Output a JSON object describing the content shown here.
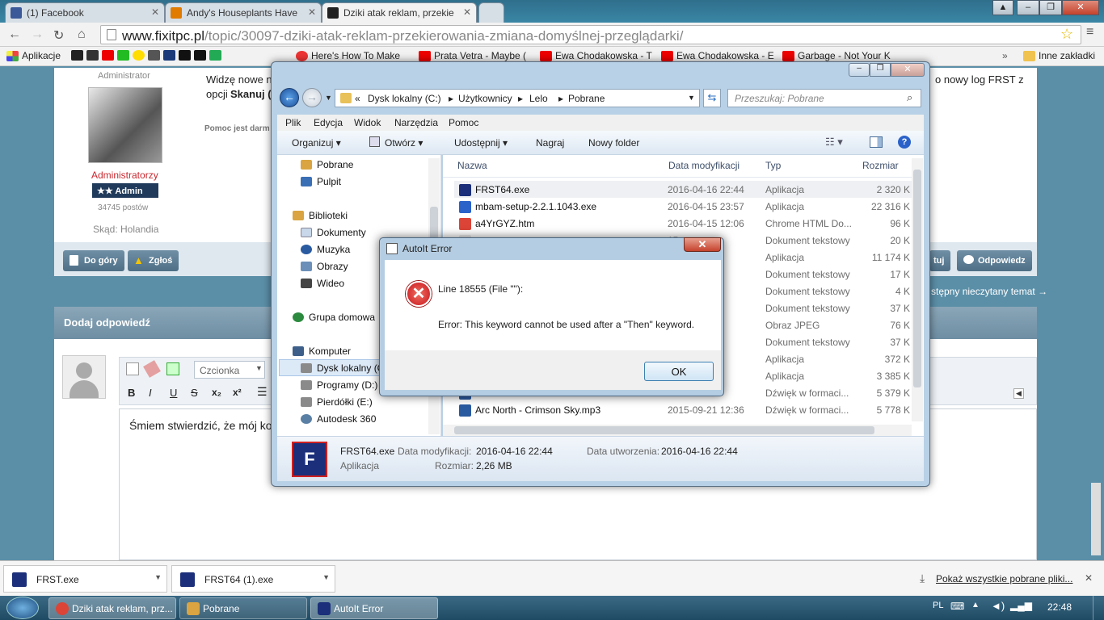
{
  "browser": {
    "tabs": [
      {
        "label": "(1) Facebook",
        "color": "#3b5998"
      },
      {
        "label": "Andy's Houseplants Have",
        "color": "#e07b00"
      },
      {
        "label": "Dziki atak reklam, przekie",
        "color": "#222222"
      }
    ],
    "url_host": "www.fixitpc.pl",
    "url_path": "/topic/30097-dziki-atak-reklam-przekierowania-zmiana-domyślnej-przeglądarki/",
    "bookmarks": [
      {
        "label": "Aplikacje",
        "color": "#e44"
      },
      {
        "label": "Here's How To Make",
        "color": "#e33"
      },
      {
        "label": "Prata Vetra - Maybe (",
        "color": "#e00"
      },
      {
        "label": "Ewa Chodakowska - T",
        "color": "#e00"
      },
      {
        "label": "Ewa Chodakowska - E",
        "color": "#e00"
      },
      {
        "label": "Garbage - Not Your K",
        "color": "#e00"
      }
    ],
    "other_bookmarks": "Inne zakładki"
  },
  "post": {
    "role": "Administrator",
    "group": "Administratorzy",
    "badge": "★★  Admin",
    "posts": "34745 postów",
    "from": "Skąd: Holandia",
    "text_left": "Widzę nowe ni",
    "text_right": "o nowy log FRST z",
    "text_line2": "opcji",
    "text_bold": "Skanuj (",
    "help_text": "Pomoc jest darm",
    "btn_top": "Do góry",
    "btn_report": "Zgłoś",
    "btn_quote": "tuj",
    "btn_reply": "Odpowiedz",
    "next_topic": "stępny nieczytany temat →"
  },
  "reply": {
    "title": "Dodaj odpowiedź",
    "font_select": "Czcionka",
    "editor_text": "Śmiem stwierdzić, że mój ko"
  },
  "explorer": {
    "address": [
      "«",
      "Dysk lokalny (C:)",
      "Użytkownicy",
      "Lelo",
      "Pobrane"
    ],
    "search_placeholder": "Przeszukaj: Pobrane",
    "menu": [
      "Plik",
      "Edycja",
      "Widok",
      "Narzędzia",
      "Pomoc"
    ],
    "commands": [
      "Organizuj ▾",
      "Otwórz ▾",
      "Udostępnij ▾",
      "Nagraj",
      "Nowy folder"
    ],
    "nav": [
      {
        "label": "Pobrane",
        "color": "#d9a441"
      },
      {
        "label": "Pulpit",
        "color": "#3a6fb5"
      },
      {
        "label": "Biblioteki",
        "color": "#d9a441"
      },
      {
        "label": "Dokumenty",
        "color": "#c8d8ea"
      },
      {
        "label": "Muzyka",
        "color": "#2a5aa0"
      },
      {
        "label": "Obrazy",
        "color": "#6b8fb8"
      },
      {
        "label": "Wideo",
        "color": "#444"
      },
      {
        "label": "Grupa domowa",
        "color": "#2b8a3e"
      },
      {
        "label": "Komputer",
        "color": "#3d5f8a"
      },
      {
        "label": "Dysk lokalny (C:)",
        "color": "#8a8a8a"
      },
      {
        "label": "Programy  (D:)",
        "color": "#8a8a8a"
      },
      {
        "label": "Pierdółki (E:)",
        "color": "#8a8a8a"
      },
      {
        "label": "Autodesk 360",
        "color": "#5a7fa5"
      }
    ],
    "columns": [
      "Nazwa",
      "Data modyfikacji",
      "Typ",
      "Rozmiar"
    ],
    "files": [
      {
        "name": "FRST64.exe",
        "date": "2016-04-16 22:44",
        "type": "Aplikacja",
        "size": "2 320 K",
        "color": "#1b2f7a"
      },
      {
        "name": "mbam-setup-2.2.1.1043.exe",
        "date": "2016-04-15 23:57",
        "type": "Aplikacja",
        "size": "22 316 K",
        "color": "#2a62c9"
      },
      {
        "name": "a4YrGYZ.htm",
        "date": "2016-04-15 12:06",
        "type": "Chrome HTML Do...",
        "size": "96 K",
        "color": "#db4437"
      },
      {
        "name": "",
        "date": "15",
        "type": "Dokument tekstowy",
        "size": "20 K",
        "color": "#eeeeee"
      },
      {
        "name": "",
        "date": "01",
        "type": "Aplikacja",
        "size": "11 174 K",
        "color": "#6b8fb8"
      },
      {
        "name": "",
        "date": "55",
        "type": "Dokument tekstowy",
        "size": "17 K",
        "color": "#eeeeee"
      },
      {
        "name": "",
        "date": "55",
        "type": "Dokument tekstowy",
        "size": "4 K",
        "color": "#eeeeee"
      },
      {
        "name": "",
        "date": "47",
        "type": "Dokument tekstowy",
        "size": "37 K",
        "color": "#eeeeee"
      },
      {
        "name": "",
        "date": "15",
        "type": "Obraz JPEG",
        "size": "76 K",
        "color": "#6b8fb8"
      },
      {
        "name": "",
        "date": "29",
        "type": "Dokument tekstowy",
        "size": "37 K",
        "color": "#eeeeee"
      },
      {
        "name": "",
        "date": "00",
        "type": "Aplikacja",
        "size": "372 K",
        "color": "#6b8fb8"
      },
      {
        "name": "",
        "date": "01",
        "type": "Aplikacja",
        "size": "3 385 K",
        "color": "#6b8fb8"
      },
      {
        "name": "",
        "date": "38",
        "type": "Dźwięk w formaci...",
        "size": "5 379 K",
        "color": "#2a5aa0"
      },
      {
        "name": "Arc North - Crimson Sky.mp3",
        "date": "2015-09-21 12:36",
        "type": "Dźwięk w formaci...",
        "size": "5 778 K",
        "color": "#2a5aa0"
      }
    ],
    "details": {
      "name": "FRST64.exe",
      "type": "Aplikacja",
      "mod_label": "Data modyfikacji:",
      "mod_value": "2016-04-16 22:44",
      "size_label": "Rozmiar:",
      "size_value": "2,26 MB",
      "created_label": "Data utworzenia:",
      "created_value": "2016-04-16 22:44"
    }
  },
  "dialog": {
    "title": "AutoIt Error",
    "line": "Line 18555  (File \"\"):",
    "error": "Error: This keyword cannot be used after a \"Then\" keyword.",
    "ok": "OK",
    "close": "✕"
  },
  "downloads": {
    "items": [
      "FRST.exe",
      "FRST64 (1).exe"
    ],
    "show_all": "Pokaż wszystkie pobrane pliki..."
  },
  "taskbar": {
    "items": [
      {
        "label": "Dziki atak reklam, prz...",
        "color": "#db4437"
      },
      {
        "label": "Pobrane",
        "color": "#d9a441"
      },
      {
        "label": "AutoIt Error",
        "color": "#1b2f7a"
      }
    ],
    "lang": "PL",
    "time": "22:48"
  }
}
